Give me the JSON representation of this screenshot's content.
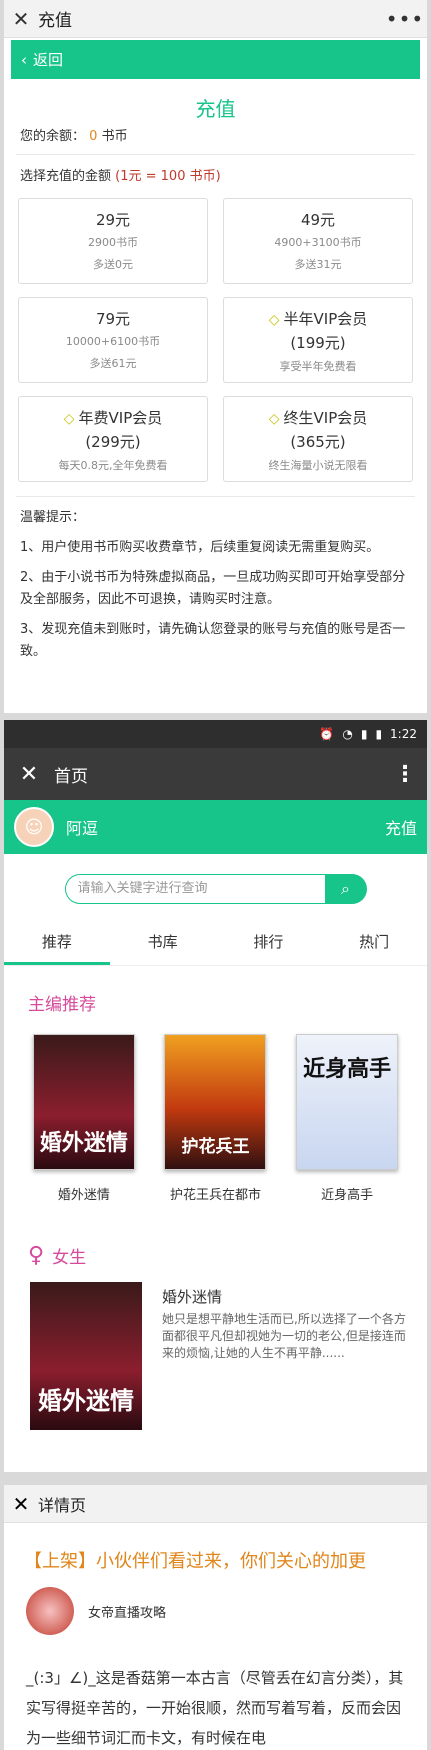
{
  "recharge_page": {
    "wx_title": "充值",
    "back_label": "返回",
    "heading": "充值",
    "balance_prefix": "您的余额：",
    "balance_value": "0",
    "balance_unit": "书币",
    "select_label": "选择充值的金额",
    "rate_note": "(1元 = 100 书币)",
    "options": [
      {
        "amount": "29元",
        "coins": "2900书币",
        "bonus": "多送0元"
      },
      {
        "amount": "49元",
        "coins": "4900+3100书币",
        "bonus": "多送31元"
      },
      {
        "amount": "79元",
        "coins": "10000+6100书币",
        "bonus": "多送61元"
      }
    ],
    "vip": [
      {
        "title": "半年VIP会员",
        "price": "(199元)",
        "desc": "享受半年免费看"
      },
      {
        "title": "年费VIP会员",
        "price": "(299元)",
        "desc": "每天0.8元,全年免费看"
      },
      {
        "title": "终生VIP会员",
        "price": "(365元)",
        "desc": "终生海量小说无限看"
      }
    ],
    "tips_title": "温馨提示：",
    "tips": [
      "1、用户使用书币购买收费章节，后续重复阅读无需重复购买。",
      "2、由于小说书币为特殊虚拟商品，一旦成功购买即可开始享受部分及全部服务，因此不可退换，请购买时注意。",
      "3、发现充值未到账时，请先确认您登录的账号与充值的账号是否一致。"
    ]
  },
  "home_page": {
    "status_time": "1:22",
    "title": "首页",
    "username": "阿逗",
    "recharge_label": "充值",
    "search_placeholder": "请输入关键字进行查询",
    "tabs": [
      "推荐",
      "书库",
      "排行",
      "热门"
    ],
    "editor_title": "主编推荐",
    "books": [
      {
        "title": "婚外迷情",
        "cover_text": "婚外迷情"
      },
      {
        "title": "护花王兵在都市",
        "cover_text": "护花兵王"
      },
      {
        "title": "近身高手",
        "cover_text": "近身高手"
      }
    ],
    "female_title": "女生",
    "featured": {
      "title": "婚外迷情",
      "desc": "她只是想平静地生活而已,所以选择了一个各方面都很平凡但却视她为一切的老公,但是接连而来的烦恼,让她的人生不再平静......",
      "cover_text": "婚外迷情"
    }
  },
  "detail_page": {
    "title": "详情页",
    "article_title": "【上架】小伙伴们看过来，你们关心的加更",
    "author": "女帝直播攻略",
    "body": "_(:3」∠)_这是香菇第一本古言（尽管丢在幻言分类），其实写得挺辛苦的，一开始很顺，然而写着写着，反而会因为一些细节词汇而卡文，有时候在电"
  },
  "colors": {
    "accent": "#17c48a",
    "section_pink": "#d64b9b",
    "gold": "#e0861a"
  }
}
